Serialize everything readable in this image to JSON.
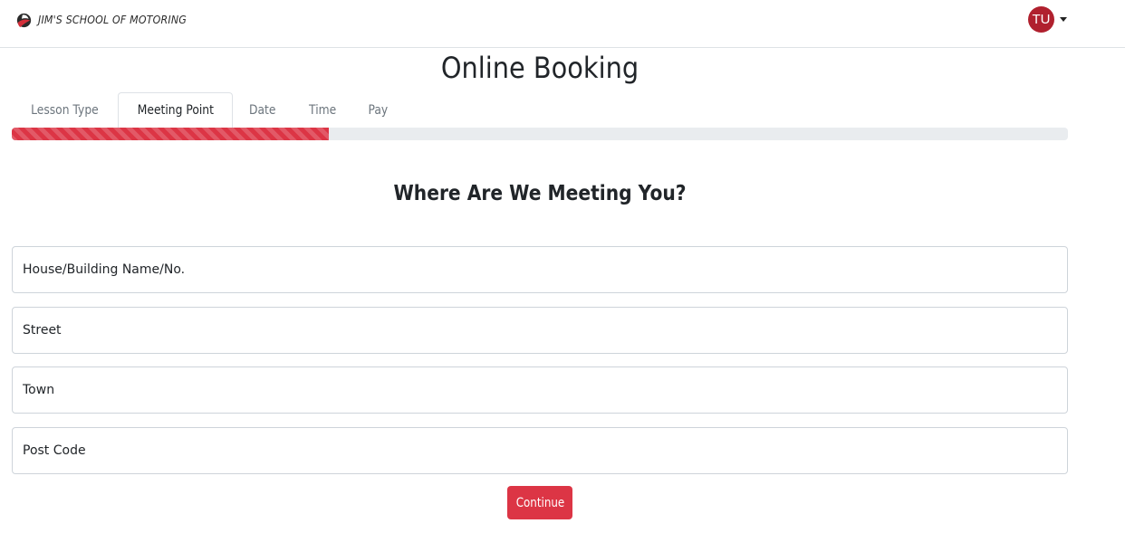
{
  "brand": {
    "name": "JIM'S SCHOOL OF MOTORING",
    "logo_icon": "steering-swoosh-icon"
  },
  "user": {
    "initials": "TU",
    "avatar_color": "#b0202e"
  },
  "page": {
    "title": "Online Booking"
  },
  "steps": [
    {
      "label": "Lesson Type",
      "active": false
    },
    {
      "label": "Meeting Point",
      "active": true
    },
    {
      "label": "Date",
      "active": false
    },
    {
      "label": "Time",
      "active": false
    },
    {
      "label": "Pay",
      "active": false
    }
  ],
  "progress": {
    "percent": 30,
    "color": "#dc3545"
  },
  "form": {
    "heading": "Where Are We Meeting You?",
    "fields": [
      {
        "placeholder": "House/Building Name/No.",
        "value": ""
      },
      {
        "placeholder": "Street",
        "value": ""
      },
      {
        "placeholder": "Town",
        "value": ""
      },
      {
        "placeholder": "Post Code",
        "value": ""
      }
    ],
    "submit_label": "Continue"
  },
  "colors": {
    "accent": "#dc3545"
  }
}
